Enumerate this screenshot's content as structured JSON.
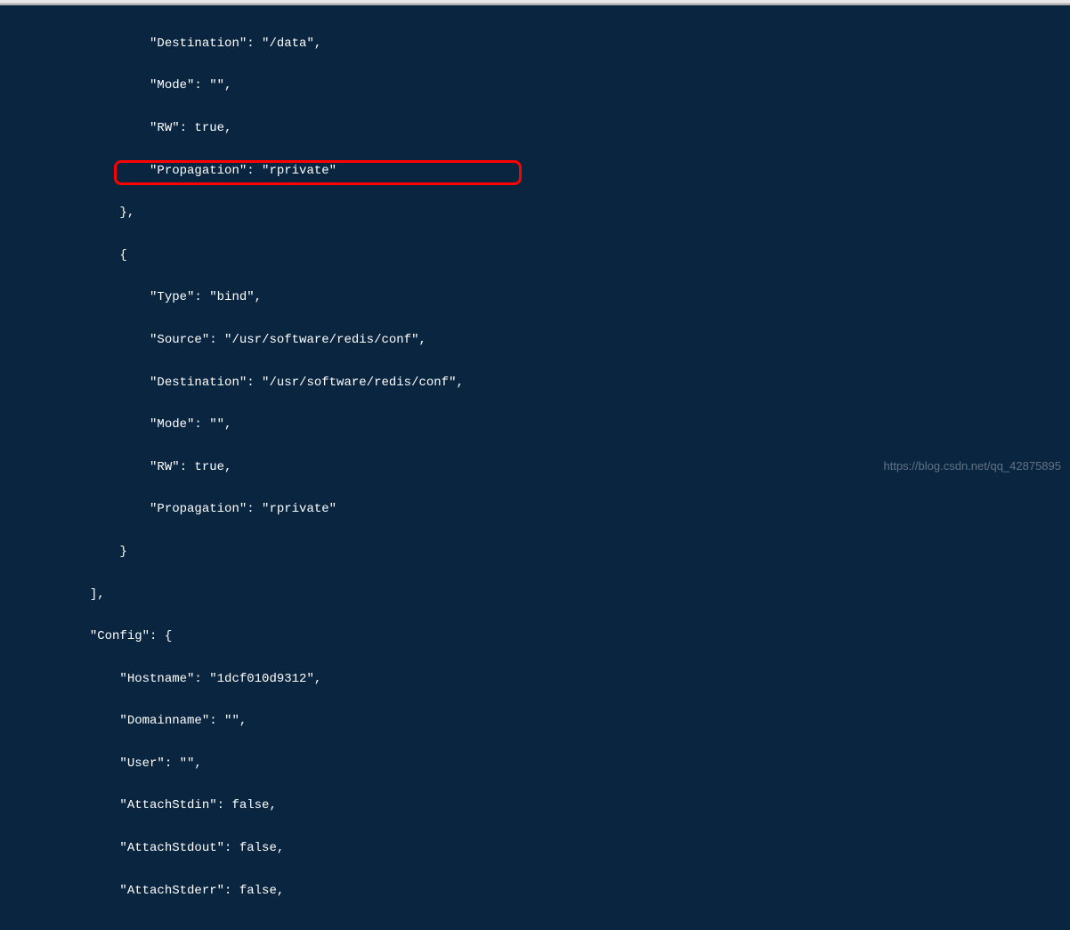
{
  "lines": [
    "            \"Destination\": \"/data\",",
    "            \"Mode\": \"\",",
    "            \"RW\": true,",
    "            \"Propagation\": \"rprivate\"",
    "        },",
    "        {",
    "            \"Type\": \"bind\",",
    "            \"Source\": \"/usr/software/redis/conf\",",
    "            \"Destination\": \"/usr/software/redis/conf\",",
    "            \"Mode\": \"\",",
    "            \"RW\": true,",
    "            \"Propagation\": \"rprivate\"",
    "        }",
    "    ],",
    "    \"Config\": {",
    "        \"Hostname\": \"1dcf010d9312\",",
    "        \"Domainname\": \"\",",
    "        \"User\": \"\",",
    "        \"AttachStdin\": false,",
    "        \"AttachStdout\": false,",
    "        \"AttachStderr\": false,"
  ],
  "watermark": "https://blog.csdn.net/qq_42875895",
  "indent_base": "        "
}
